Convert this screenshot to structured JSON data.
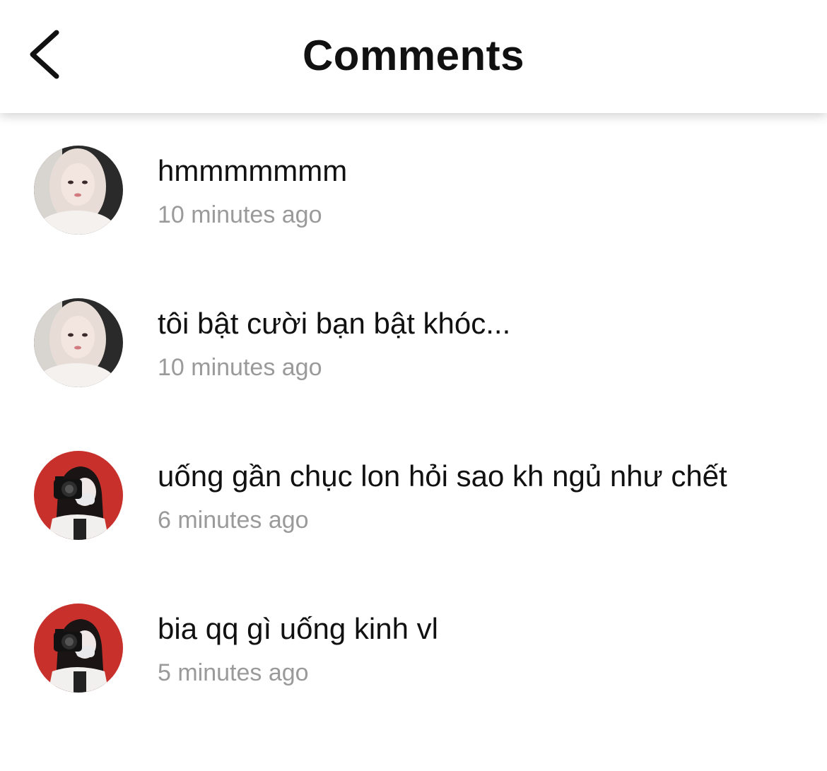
{
  "header": {
    "title": "Comments",
    "back_icon": "chevron-left-icon"
  },
  "comments": [
    {
      "text": "hmmmmmmm",
      "time": "10 minutes ago",
      "avatar": "blonde-girl"
    },
    {
      "text": "tôi bật cười bạn bật khóc...",
      "time": "10 minutes ago",
      "avatar": "blonde-girl"
    },
    {
      "text": "uống gần chục lon hỏi sao kh ngủ như chết",
      "time": "6 minutes ago",
      "avatar": "camera-girl-red"
    },
    {
      "text": "bia qq gì uống kinh vl",
      "time": "5 minutes ago",
      "avatar": "camera-girl-red"
    }
  ]
}
